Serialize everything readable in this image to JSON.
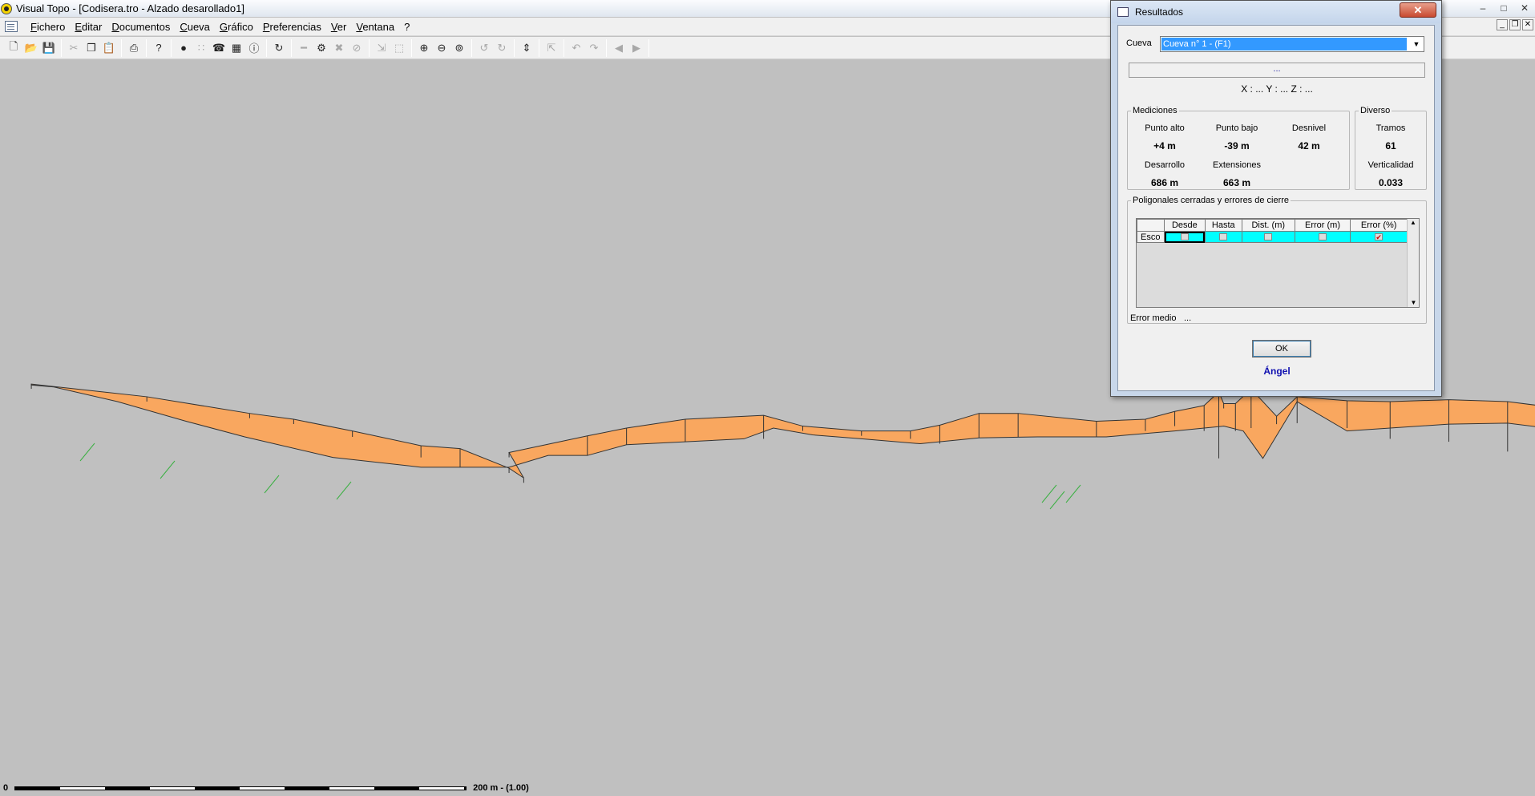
{
  "window": {
    "title": "Visual Topo - [Codisera.tro - Alzado desarollado1]"
  },
  "menu": [
    "Fichero",
    "Editar",
    "Documentos",
    "Cueva",
    "Gráfico",
    "Preferencias",
    "Ver",
    "Ventana",
    "?"
  ],
  "toolbar": {
    "buttons": [
      "new-icon",
      "open-icon",
      "save-icon",
      "cut-icon",
      "copy-icon",
      "paste-icon",
      "print-icon",
      "help-icon",
      "globe-icon",
      "tree-icon",
      "network-icon",
      "table-icon",
      "info-icon",
      "refresh-icon",
      "minus-icon",
      "settings-icon",
      "cross-icon",
      "zoom-reset-icon",
      "fit-icon",
      "select-icon",
      "zoom-in-icon",
      "zoom-out-icon",
      "zoom-window-icon",
      "rotate-left-icon",
      "rotate-right-icon",
      "vertical-icon",
      "export-icon",
      "undo-icon",
      "redo-icon",
      "back-icon",
      "forward-icon"
    ]
  },
  "scale": {
    "start": "0",
    "label": "200 m - (1.00)"
  },
  "colors": {
    "passage_fill": "#f9a75f",
    "station_labels": "#2020d0",
    "splays": "#3cb043"
  },
  "dialog": {
    "title": "Resultados",
    "cave_label": "Cueva",
    "cave_selected": "Cueva n° 1 - (F1)",
    "path_text": "...",
    "coords": "X : ...  Y : ...  Z : ...",
    "mediciones": {
      "legend": "Mediciones",
      "punto_alto_label": "Punto alto",
      "punto_alto_value": "+4 m",
      "punto_bajo_label": "Punto bajo",
      "punto_bajo_value": "-39 m",
      "desnivel_label": "Desnivel",
      "desnivel_value": "42 m",
      "desarrollo_label": "Desarrollo",
      "desarrollo_value": "686 m",
      "extensiones_label": "Extensiones",
      "extensiones_value": "663 m"
    },
    "diverso": {
      "legend": "Diverso",
      "tramos_label": "Tramos",
      "tramos_value": "61",
      "verticalidad_label": "Verticalidad",
      "verticalidad_value": "0.033"
    },
    "poligonales": {
      "legend": "Poligonales cerradas y errores de cierre",
      "columns": [
        "Desde",
        "Hasta",
        "Dist. (m)",
        "Error (m)",
        "Error (%)"
      ],
      "row_header": "Esco"
    },
    "error_medio_label": "Error medio",
    "error_medio_value": "...",
    "ok_label": "OK",
    "author": "Ángel"
  }
}
